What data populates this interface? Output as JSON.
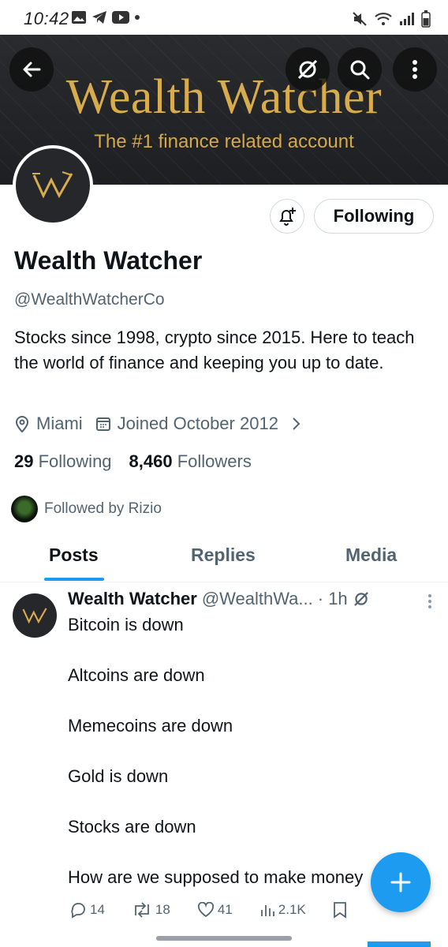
{
  "status_bar": {
    "time": "10:42"
  },
  "banner": {
    "title": "Wealth Watcher",
    "subtitle": "The #1 finance related account",
    "colors": {
      "gold": "#d8ac4c",
      "bg": "#232427"
    }
  },
  "profile": {
    "follow_button_label": "Following",
    "name": "Wealth Watcher",
    "handle": "@WealthWatcherCo",
    "bio": "Stocks since 1998, crypto since 2015. Here to teach the world of finance and keeping you up to date.",
    "location": "Miami",
    "joined": "Joined October 2012",
    "following_count": "29",
    "following_label": "Following",
    "followers_count": "8,460",
    "followers_label": "Followers",
    "followed_by": "Followed by Rizio"
  },
  "tabs": [
    {
      "label": "Posts"
    },
    {
      "label": "Replies"
    },
    {
      "label": "Media"
    }
  ],
  "tweet": {
    "author": "Wealth Watcher",
    "handle": "@WealthWa...",
    "time": "· 1h",
    "lines": [
      "Bitcoin is down",
      "Altcoins are down",
      "Memecoins are down",
      "Gold is down",
      "Stocks are down",
      "How are we supposed to make money"
    ],
    "replies": "14",
    "retweets": "18",
    "likes": "41",
    "views": "2.1K"
  },
  "accent_color": "#1d9bf0"
}
